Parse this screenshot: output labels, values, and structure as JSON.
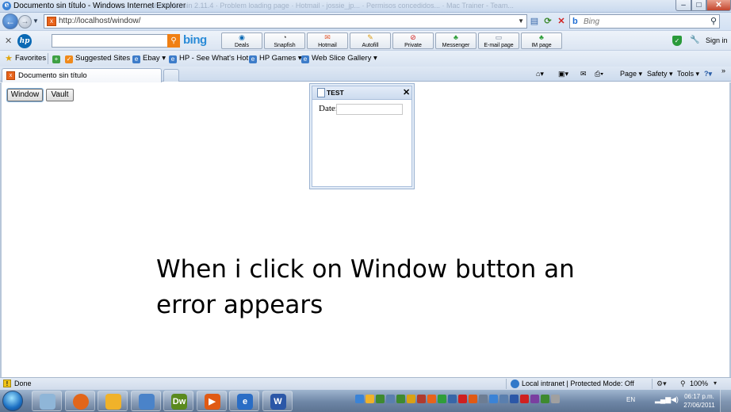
{
  "window": {
    "title": "Documento sin título - Windows Internet Explorer",
    "ghost_tabs": "phpMyAdmin 2.11.4   ·   Problem loading page   ·   Hotmail - jossie_jp...   ·   Permisos concedidos...   ·   Mac Trainer - Team..."
  },
  "nav": {
    "url": "http://localhost/window/",
    "search_placeholder": "Bing"
  },
  "hp_toolbar": {
    "buttons": [
      {
        "icon": "hp-deals-icon",
        "label": "Deals"
      },
      {
        "icon": "snapfish-icon",
        "label": "Snapfish"
      },
      {
        "icon": "hotmail-icon",
        "label": "Hotmail"
      },
      {
        "icon": "autofill-icon",
        "label": "Autofill"
      },
      {
        "icon": "private-icon",
        "label": "Private"
      },
      {
        "icon": "messenger-icon",
        "label": "Messenger"
      },
      {
        "icon": "email-page-icon",
        "label": "E-mail page"
      },
      {
        "icon": "im-page-icon",
        "label": "IM page"
      }
    ],
    "bing": "bing",
    "sign_in": "Sign in"
  },
  "favorites": {
    "label": "Favorites",
    "items": [
      "Suggested Sites ▾",
      "Ebay ▾",
      "HP - See What's Hot ▾",
      "HP Games ▾",
      "Web Slice Gallery ▾"
    ]
  },
  "tabs": {
    "active_label": "Documento sin título"
  },
  "command_bar": {
    "page": "Page ▾",
    "safety": "Safety ▾",
    "tools": "Tools ▾"
  },
  "page": {
    "window_button": "Window",
    "vault_button": "Vault",
    "dialog": {
      "title": "TEST",
      "close": "✕",
      "date_label": "Date:",
      "date_value": ""
    },
    "annotation_line1": "When i click on Window button an",
    "annotation_line2": "error appears"
  },
  "status": {
    "text": "Done",
    "zone": "Local intranet | Protected Mode: Off",
    "zoom": "100%"
  },
  "taskbar": {
    "lang": "EN",
    "time": "06:17 p.m.",
    "date": "27/06/2011",
    "apps": [
      "explorer-icon",
      "firefox-icon",
      "outlook-icon",
      "files-icon",
      "dreamweaver-icon",
      "media-player-icon",
      "internet-explorer-icon",
      "word-icon"
    ]
  },
  "colors": {
    "chrome_blue": "#dbe5f2",
    "accent_orange": "#e8631b",
    "taskbar": "#6e86a6"
  }
}
